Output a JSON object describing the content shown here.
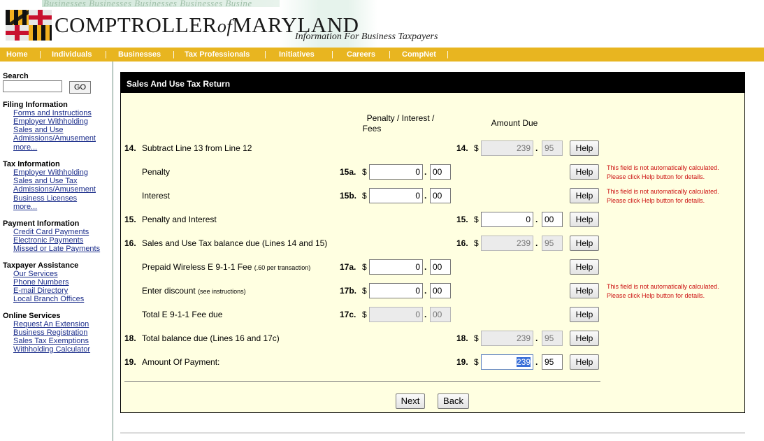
{
  "header": {
    "banner_text": "Businesses  Businesses  Businesses  Businesses  Busine",
    "title_left": "COMPTROLLER",
    "title_of": "of",
    "title_right": "MARYLAND",
    "subtitle": "Information For Business Taxpayers"
  },
  "nav": {
    "items": [
      "Home",
      "Individuals",
      "Businesses",
      "Tax Professionals",
      "Initiatives",
      "Careers",
      "CompNet"
    ],
    "separator": "|"
  },
  "sidebar": {
    "search_label": "Search",
    "search_placeholder": "",
    "go_label": "GO",
    "sections": [
      {
        "title": "Filing Information",
        "links": [
          "Forms and Instructions",
          "Employer Withholding",
          "Sales and Use",
          "Admissions/Amusement",
          "more..."
        ]
      },
      {
        "title": "Tax Information",
        "links": [
          "Employer Withholding",
          "Sales and Use Tax",
          "Admissions/Amusement",
          "Business Licenses",
          "more..."
        ]
      },
      {
        "title": "Payment Information",
        "links": [
          "Credit Card Payments",
          "Electronic Payments",
          "Missed or Late Payments"
        ]
      },
      {
        "title": "Taxpayer Assistance",
        "links": [
          "Our Services",
          "Phone Numbers",
          "E-mail Directory",
          "Local Branch Offices"
        ]
      },
      {
        "title": "Online Services",
        "links": [
          "Request An Extension",
          "Business Registration",
          "Sales Tax Exemptions",
          "Withholding Calculator"
        ]
      }
    ]
  },
  "form": {
    "title": "Sales And Use Tax Return",
    "col_penalty_line1": "Penalty / Interest /",
    "col_penalty_line2": "Fees",
    "col_amount": "Amount Due",
    "dollar": "$",
    "dot": ".",
    "help_label": "Help",
    "note_line1": "This field is not automatically calculated.",
    "note_line2": "Please click Help button for details.",
    "rows": [
      {
        "num": "14.",
        "label": "Subtract Line 13 from Line 12",
        "sublabel": "",
        "right_num": "14.",
        "dollars": "239",
        "cents": "95",
        "readonly": true
      },
      {
        "num": "",
        "label": "Penalty",
        "sublabel": "",
        "left_num": "15a.",
        "dollars": "0",
        "cents": "00",
        "readonly": false,
        "note": true
      },
      {
        "num": "",
        "label": "Interest",
        "sublabel": "",
        "left_num": "15b.",
        "dollars": "0",
        "cents": "00",
        "readonly": false,
        "note": true
      },
      {
        "num": "15.",
        "label": "Penalty and Interest",
        "sublabel": "",
        "right_num": "15.",
        "dollars": "0",
        "cents": "00",
        "readonly": false
      },
      {
        "num": "16.",
        "label": "Sales and Use Tax balance due (Lines 14 and 15)",
        "sublabel": "",
        "right_num": "16.",
        "dollars": "239",
        "cents": "95",
        "readonly": true
      },
      {
        "num": "",
        "label": "Prepaid Wireless E 9-1-1 Fee",
        "sublabel": "(.60 per transaction)",
        "left_num": "17a.",
        "dollars": "0",
        "cents": "00",
        "readonly": false
      },
      {
        "num": "",
        "label": "Enter discount",
        "sublabel": "(see instructions)",
        "left_num": "17b.",
        "dollars": "0",
        "cents": "00",
        "readonly": false,
        "note": true
      },
      {
        "num": "",
        "label": "Total E 9-1-1 Fee due",
        "sublabel": "",
        "left_num": "17c.",
        "dollars": "0",
        "cents": "00",
        "readonly": true
      },
      {
        "num": "18.",
        "label": "Total balance due (Lines 16 and 17c)",
        "sublabel": "",
        "right_num": "18.",
        "dollars": "239",
        "cents": "95",
        "readonly": true
      },
      {
        "num": "19.",
        "label": "Amount Of Payment:",
        "sublabel": "",
        "right_num": "19.",
        "dollars": "239",
        "cents": "95",
        "readonly": false,
        "selected": true
      }
    ],
    "next_label": "Next",
    "back_label": "Back"
  }
}
